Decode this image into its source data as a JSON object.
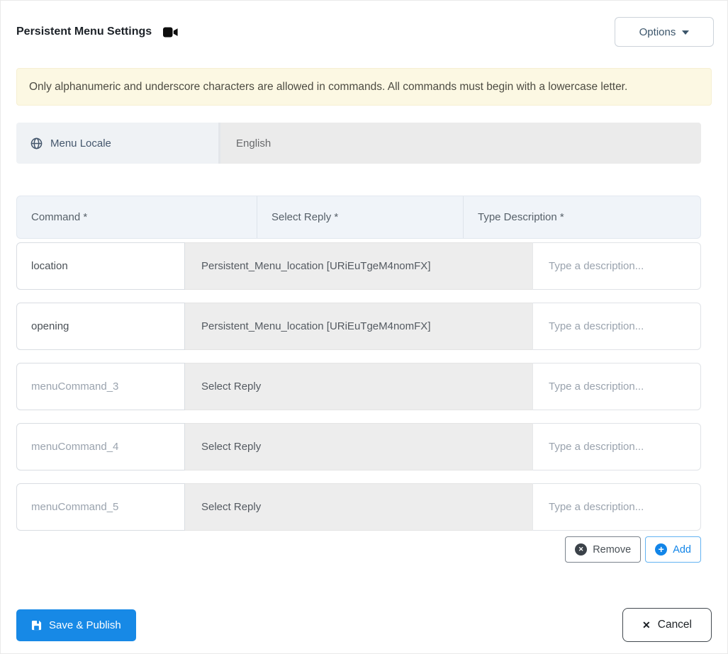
{
  "header": {
    "title": "Persistent Menu Settings",
    "video_icon": "video-camera-icon",
    "options_label": "Options"
  },
  "alert": {
    "text": "Only alphanumeric and underscore characters are allowed in commands. All commands must begin with a lowercase letter."
  },
  "locale": {
    "icon": "globe-icon",
    "label": "Menu Locale",
    "value": "English"
  },
  "table": {
    "columns": [
      {
        "label": "Command *"
      },
      {
        "label": "Select Reply *"
      },
      {
        "label": "Type Description *"
      }
    ],
    "rows": [
      {
        "command": "location",
        "command_is_placeholder": false,
        "reply": "Persistent_Menu_location [URiEuTgeM4nomFX]",
        "reply_is_selected": true,
        "description_value": "",
        "description_placeholder": "Type a description..."
      },
      {
        "command": "opening",
        "command_is_placeholder": false,
        "reply": "Persistent_Menu_location [URiEuTgeM4nomFX]",
        "reply_is_selected": true,
        "description_value": "",
        "description_placeholder": "Type a description..."
      },
      {
        "command": "menuCommand_3",
        "command_is_placeholder": true,
        "reply": "Select Reply",
        "reply_is_selected": false,
        "description_value": "",
        "description_placeholder": "Type a description..."
      },
      {
        "command": "menuCommand_4",
        "command_is_placeholder": true,
        "reply": "Select Reply",
        "reply_is_selected": false,
        "description_value": "",
        "description_placeholder": "Type a description..."
      },
      {
        "command": "menuCommand_5",
        "command_is_placeholder": true,
        "reply": "Select Reply",
        "reply_is_selected": false,
        "description_value": "",
        "description_placeholder": "Type a description..."
      }
    ]
  },
  "actions": {
    "remove_label": "Remove",
    "add_label": "Add",
    "remove_icon": "circle-x-icon",
    "add_icon": "circle-plus-icon"
  },
  "footer": {
    "save_label": "Save & Publish",
    "save_icon": "floppy-save-icon",
    "cancel_label": "Cancel",
    "cancel_icon": "x-icon"
  },
  "colors": {
    "primary_blue": "#1789e6",
    "add_blue": "#1285e8",
    "alert_bg": "#fcf8e3",
    "header_bg": "#f0f4f9",
    "reply_bg": "#ededed",
    "locale_label_bg": "#eff2f5",
    "locale_value_bg": "#ebebeb"
  }
}
